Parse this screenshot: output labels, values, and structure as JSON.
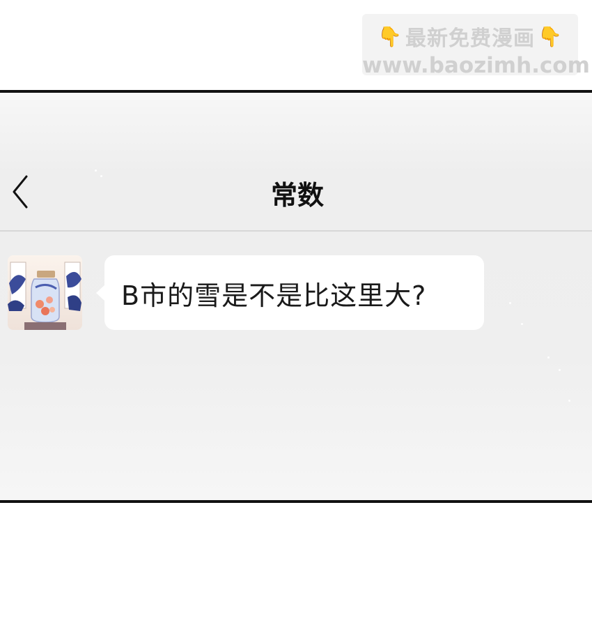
{
  "watermark": {
    "line1": "最新免费漫画",
    "line2": "www.baozimh.com"
  },
  "chat": {
    "title": "常数",
    "back_icon": "chevron-left-icon",
    "messages": [
      {
        "text": "B市的雪是不是比这里大?",
        "avatar": "jar-avatar"
      }
    ]
  },
  "colors": {
    "background": "#efefef",
    "bubble": "#ffffff",
    "border": "#111111"
  }
}
